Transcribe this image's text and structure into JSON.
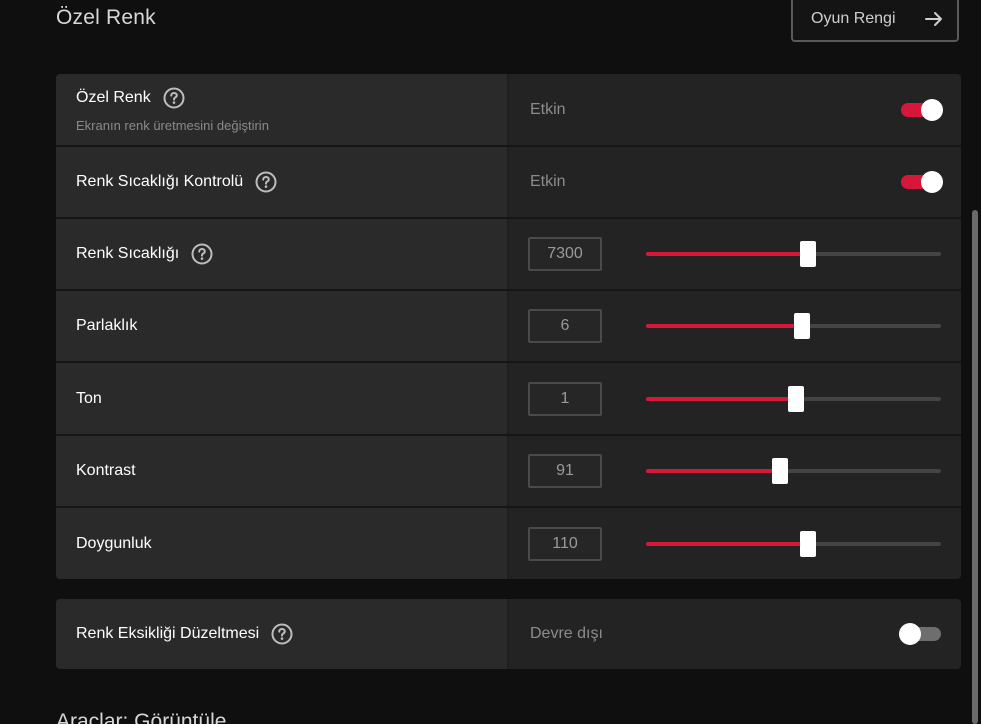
{
  "header": {
    "title": "Özel Renk",
    "game_color_button": "Oyun Rengi",
    "arrow_icon": "arrow-right-icon"
  },
  "rows": {
    "custom_color": {
      "label": "Özel Renk",
      "sublabel": "Ekranın renk üretmesini değiştirin",
      "status": "Etkin",
      "enabled": true
    },
    "temp_control": {
      "label": "Renk Sıcaklığı Kontrolü",
      "status": "Etkin",
      "enabled": true
    },
    "temperature": {
      "label": "Renk Sıcaklığı",
      "value": "7300",
      "fraction": 0.55
    },
    "brightness": {
      "label": "Parlaklık",
      "value": "6",
      "fraction": 0.53
    },
    "hue": {
      "label": "Ton",
      "value": "1",
      "fraction": 0.51
    },
    "contrast": {
      "label": "Kontrast",
      "value": "91",
      "fraction": 0.455
    },
    "saturation": {
      "label": "Doygunluk",
      "value": "110",
      "fraction": 0.55
    },
    "color_deficiency": {
      "label": "Renk Eksikliği Düzeltmesi",
      "status": "Devre dışı",
      "enabled": false
    }
  },
  "next_section": {
    "title": "Araçlar: Görüntüle"
  },
  "colors": {
    "accent": "#d6173a",
    "background": "#0f0f0f",
    "label_panel": "#2a2a2a",
    "control_panel": "#232323"
  }
}
